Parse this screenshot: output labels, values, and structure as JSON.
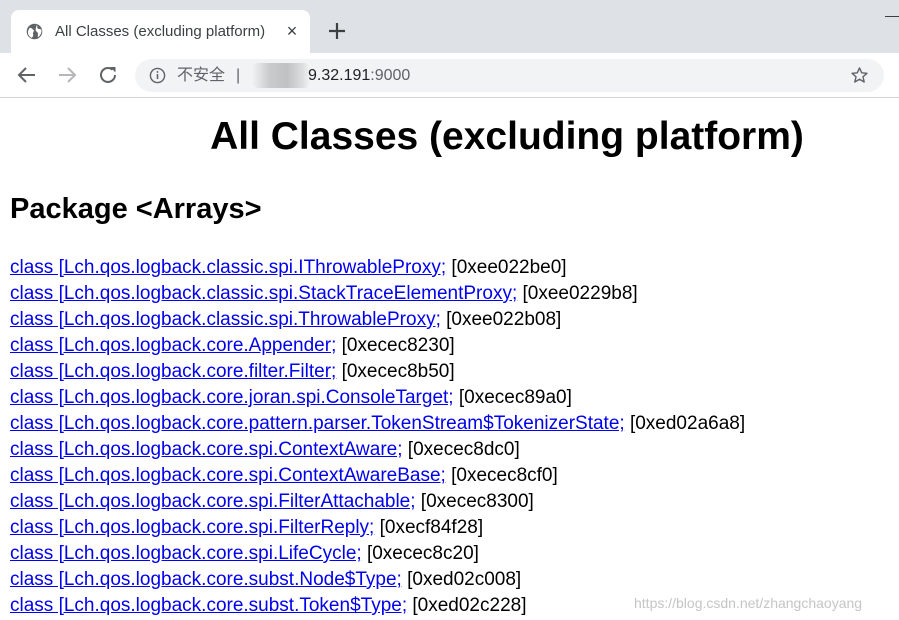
{
  "browser": {
    "tab": {
      "title": "All Classes (excluding platform)",
      "close_glyph": "×",
      "icon": "globe-icon"
    },
    "new_tab_icon": "plus-icon",
    "nav": {
      "back_icon": "back-arrow-icon",
      "forward_icon": "forward-arrow-icon",
      "reload_icon": "reload-icon"
    },
    "omnibox": {
      "security_icon": "info-icon",
      "security_label": "不安全",
      "separator": "|",
      "url_host": "9.32.191",
      "url_port": ":9000",
      "bookmark_icon": "star-icon"
    }
  },
  "page": {
    "title": "All Classes (excluding platform)",
    "package_heading": "Package <Arrays>",
    "classes": [
      {
        "link": "class [Lch.qos.logback.classic.spi.IThrowableProxy;",
        "address": " [0xee022be0]"
      },
      {
        "link": "class [Lch.qos.logback.classic.spi.StackTraceElementProxy;",
        "address": " [0xee0229b8]"
      },
      {
        "link": "class [Lch.qos.logback.classic.spi.ThrowableProxy;",
        "address": " [0xee022b08]"
      },
      {
        "link": "class [Lch.qos.logback.core.Appender;",
        "address": " [0xecec8230]"
      },
      {
        "link": "class [Lch.qos.logback.core.filter.Filter;",
        "address": " [0xecec8b50]"
      },
      {
        "link": "class [Lch.qos.logback.core.joran.spi.ConsoleTarget;",
        "address": " [0xecec89a0]"
      },
      {
        "link": "class [Lch.qos.logback.core.pattern.parser.TokenStream$TokenizerState;",
        "address": " [0xed02a6a8]"
      },
      {
        "link": "class [Lch.qos.logback.core.spi.ContextAware;",
        "address": " [0xecec8dc0]"
      },
      {
        "link": "class [Lch.qos.logback.core.spi.ContextAwareBase;",
        "address": " [0xecec8cf0]"
      },
      {
        "link": "class [Lch.qos.logback.core.spi.FilterAttachable;",
        "address": " [0xecec8300]"
      },
      {
        "link": "class [Lch.qos.logback.core.spi.FilterReply;",
        "address": " [0xecf84f28]"
      },
      {
        "link": "class [Lch.qos.logback.core.spi.LifeCycle;",
        "address": " [0xecec8c20]"
      },
      {
        "link": "class [Lch.qos.logback.core.subst.Node$Type;",
        "address": " [0xed02c008]"
      },
      {
        "link": "class [Lch.qos.logback.core.subst.Token$Type;",
        "address": " [0xed02c228]"
      }
    ],
    "watermark": "https://blog.csdn.net/zhangchaoyang"
  },
  "colors": {
    "link": "#0000ee",
    "tabstrip": "#dee1e6",
    "omnibox": "#f1f3f4"
  }
}
